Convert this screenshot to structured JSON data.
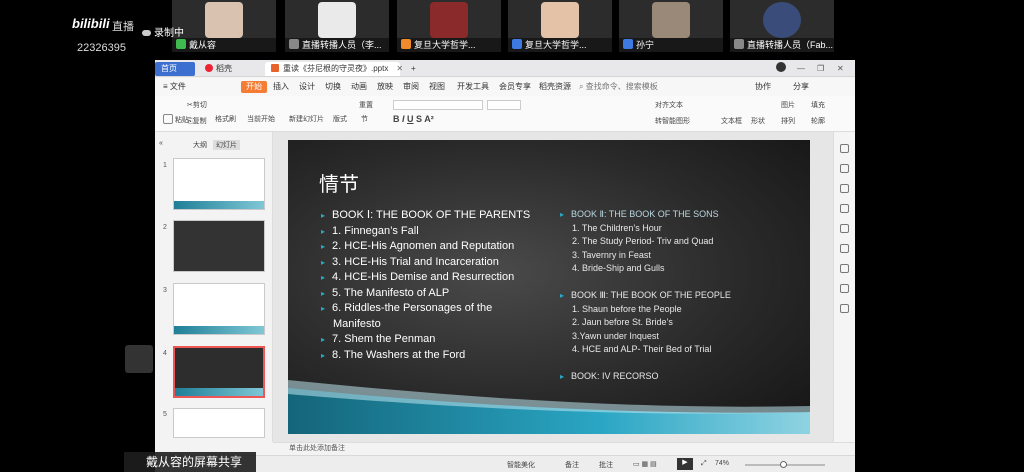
{
  "stream": {
    "bili_logo": "bilibili",
    "live_label": "直播",
    "room_id": "22326395",
    "recording_label": "录制中",
    "share_label": "戴从容的屏幕共享"
  },
  "participants": [
    {
      "name": "戴从容"
    },
    {
      "name": "直播转播人员（李..."
    },
    {
      "name": "复旦大学哲学..."
    },
    {
      "name": "复旦大学哲学..."
    },
    {
      "name": "孙宁"
    },
    {
      "name": "直播转播人员（Fab..."
    }
  ],
  "app": {
    "tabs": {
      "home": "首页",
      "shell": "稻壳",
      "doc": "重读《芬尼根的守灵夜》.pptx",
      "add": "+"
    },
    "menus": [
      "文件",
      "开始",
      "插入",
      "设计",
      "切换",
      "动画",
      "放映",
      "审阅",
      "视图",
      "开发工具",
      "会员专享",
      "稻壳资源"
    ],
    "search_placeholder": "查找命令、搜索模板",
    "right_menu": {
      "collab": "协作",
      "share": "分享"
    },
    "ribbon": {
      "paste": "粘贴",
      "cut": "剪切",
      "copy": "复制",
      "format_painter": "格式刷",
      "from_current": "当前开始",
      "new_slide": "新建幻灯片",
      "layout": "版式",
      "section": "节",
      "reset": "重置",
      "text_box": "文本框",
      "shape": "形状",
      "arrange": "排列",
      "picture": "图片",
      "fill": "填充",
      "outline": "轮廓",
      "align_text": "对齐文本",
      "convert_smartart": "转智能图形"
    },
    "panel_tabs": {
      "outline": "大纲",
      "slides": "幻灯片"
    },
    "slides": [
      {
        "num": "1"
      },
      {
        "num": "2"
      },
      {
        "num": "3"
      },
      {
        "num": "4"
      },
      {
        "num": "5"
      }
    ],
    "notes_placeholder": "单击此处添加备注",
    "status": {
      "smart_beautify": "智能美化",
      "notes": "备注",
      "comments": "批注",
      "zoom": "74%"
    }
  },
  "slide": {
    "title": "情节",
    "book1": {
      "heading": "BOOK Ⅰ: THE BOOK OF THE PARENTS",
      "items": [
        "1. Finnegan’s Fall",
        "2. HCE-His Agnomen and Reputation",
        "3. HCE-His Trial and Incarceration",
        "4. HCE-His Demise and Resurrection",
        "5. The Manifesto of ALP",
        "6. Riddles-the Personages of the",
        "Manifesto",
        "7. Shem the Penman",
        "8. The Washers at the Ford"
      ]
    },
    "book2": {
      "heading": "BOOK Ⅱ: THE BOOK OF THE SONS",
      "items": [
        "1. The Children’s Hour",
        "2. The Study Period- Triv and Quad",
        "3. Tavernry in Feast",
        "4. Bride-Ship and Gulls"
      ]
    },
    "book3": {
      "heading": "BOOK Ⅲ: THE BOOK OF THE PEOPLE",
      "items": [
        "1. Shaun before the People",
        "2. Jaun before St. Bride’s",
        "3.Yawn under Inquest",
        "4. HCE and ALP- Their Bed of Trial"
      ]
    },
    "book4": {
      "heading": "BOOK: IV RECORSO"
    },
    "colors": {
      "bullet": "#29a9c7",
      "accent": "#1f7f97"
    }
  }
}
